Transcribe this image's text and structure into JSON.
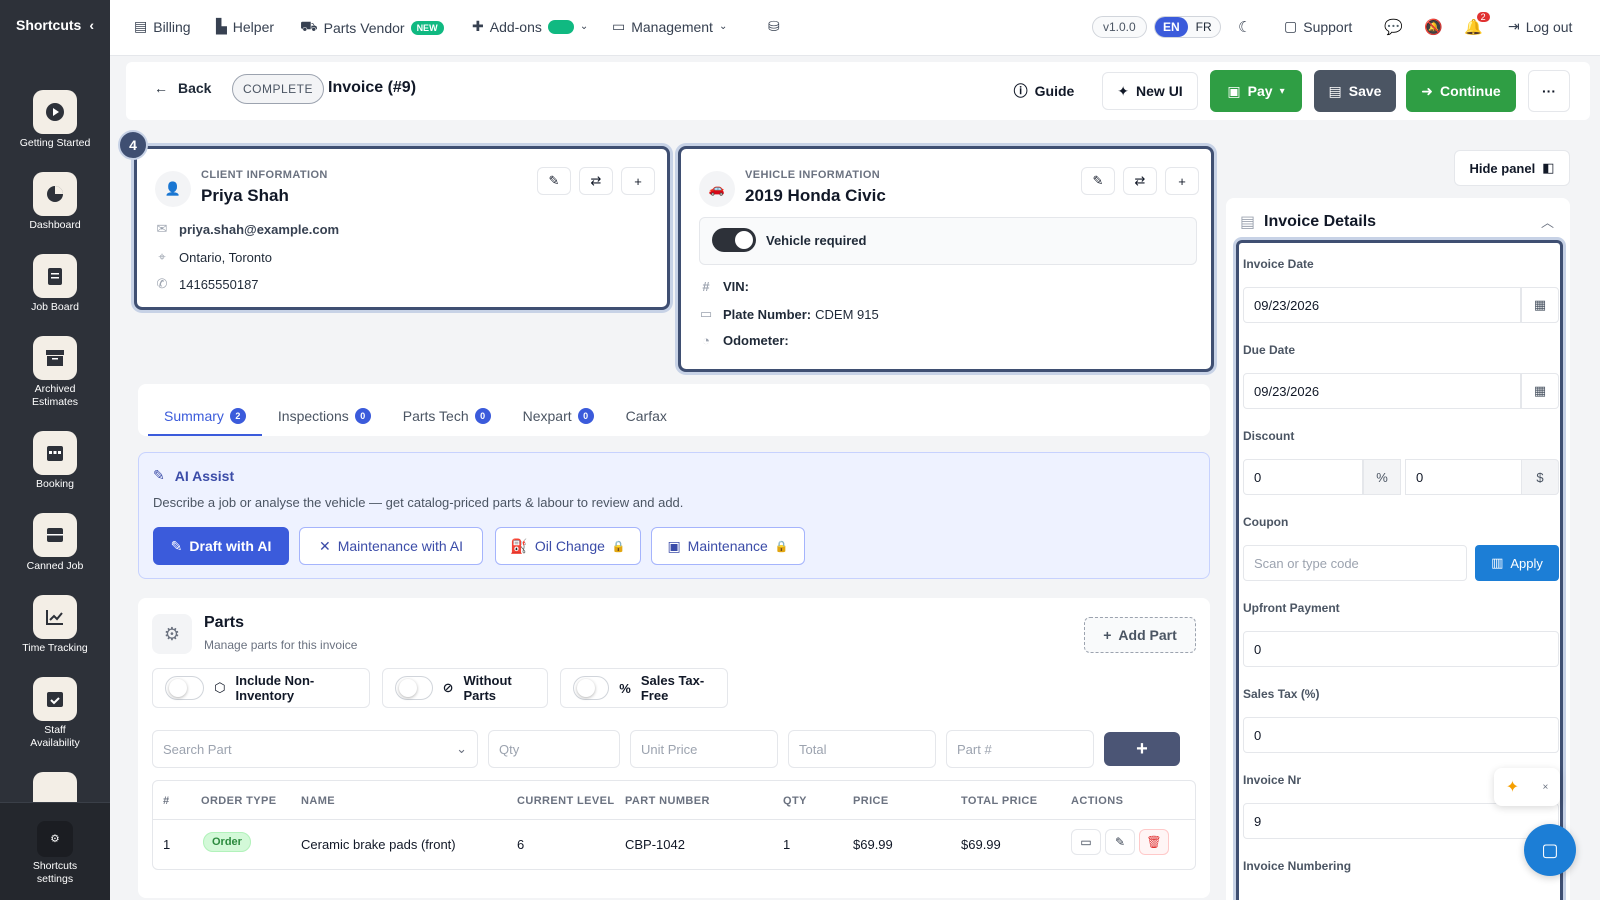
{
  "sidebar": {
    "title": "Shortcuts",
    "items": [
      {
        "label": "Getting Started",
        "icon": "play-icon"
      },
      {
        "label": "Dashboard",
        "icon": "pie-chart-icon"
      },
      {
        "label": "Job Board",
        "icon": "clipboard-icon"
      },
      {
        "label": "Archived Estimates",
        "icon": "archive-icon"
      },
      {
        "label": "Booking",
        "icon": "calendar-icon"
      },
      {
        "label": "Canned Job",
        "icon": "box-icon"
      },
      {
        "label": "Time Tracking",
        "icon": "chart-icon"
      },
      {
        "label": "Staff Availability",
        "icon": "calendar-check-icon"
      }
    ],
    "settings_label": "Shortcuts settings"
  },
  "topbar": {
    "billing": "Billing",
    "helper": "Helper",
    "parts_vendor": "Parts Vendor",
    "new_badge": "NEW",
    "addons": "Add-ons",
    "management": "Management",
    "version": "v1.0.0",
    "lang_en": "EN",
    "lang_fr": "FR",
    "support": "Support",
    "notif_count": "2",
    "logout": "Log out"
  },
  "subbar": {
    "back": "Back",
    "status": "COMPLETE",
    "title": "Invoice (#9)",
    "guide": "Guide",
    "new_ui": "New UI",
    "pay": "Pay",
    "save": "Save",
    "continue": "Continue",
    "more": "···"
  },
  "step_badge": "4",
  "client": {
    "section_label": "CLIENT INFORMATION",
    "name": "Priya Shah",
    "email": "priya.shah@example.com",
    "location": "Ontario, Toronto",
    "phone": "14165550187"
  },
  "vehicle": {
    "section_label": "VEHICLE INFORMATION",
    "name": "2019 Honda Civic",
    "required_label": "Vehicle required",
    "vin_label": "VIN:",
    "vin_value": "",
    "plate_label": "Plate Number:",
    "plate_value": "CDEM 915",
    "odometer_label": "Odometer:",
    "odometer_value": ""
  },
  "tabs": [
    {
      "label": "Summary",
      "count": "2"
    },
    {
      "label": "Inspections",
      "count": "0"
    },
    {
      "label": "Parts Tech",
      "count": "0"
    },
    {
      "label": "Nexpart",
      "count": "0"
    },
    {
      "label": "Carfax",
      "count": ""
    }
  ],
  "ai_assist": {
    "title": "AI Assist",
    "description": "Describe a job or analyse the vehicle — get catalog-priced parts & labour to review and add.",
    "draft": "Draft with AI",
    "maintenance_ai": "Maintenance with AI",
    "oil_change": "Oil Change",
    "maintenance": "Maintenance"
  },
  "parts": {
    "title": "Parts",
    "subtitle": "Manage parts for this invoice",
    "add_part": "Add Part",
    "include_non_inventory": "Include Non-Inventory",
    "without_parts": "Without Parts",
    "sales_tax_free": "Sales Tax-Free",
    "search_placeholder": "Search Part",
    "qty_placeholder": "Qty",
    "unit_price_placeholder": "Unit Price",
    "total_placeholder": "Total",
    "part_num_placeholder": "Part #",
    "columns": [
      "#",
      "ORDER TYPE",
      "NAME",
      "CURRENT LEVEL",
      "PART NUMBER",
      "QTY",
      "PRICE",
      "TOTAL PRICE",
      "ACTIONS"
    ],
    "rows": [
      {
        "num": "1",
        "order_type": "Order",
        "name": "Ceramic brake pads (front)",
        "level": "6",
        "part_number": "CBP-1042",
        "qty": "1",
        "price": "$69.99",
        "total": "$69.99"
      }
    ]
  },
  "right_panel": {
    "hide_panel": "Hide panel",
    "title": "Invoice Details",
    "invoice_date_label": "Invoice Date",
    "invoice_date": "09/23/2026",
    "due_date_label": "Due Date",
    "due_date": "09/23/2026",
    "discount_label": "Discount",
    "discount_pct": "0",
    "pct_symbol": "%",
    "discount_amt": "0",
    "dollar_symbol": "$",
    "coupon_label": "Coupon",
    "coupon_placeholder": "Scan or type code",
    "apply": "Apply",
    "upfront_label": "Upfront Payment",
    "upfront": "0",
    "sales_tax_label": "Sales Tax (%)",
    "sales_tax": "0",
    "invoice_nr_label": "Invoice Nr",
    "invoice_nr": "9",
    "invoice_numbering_label": "Invoice Numbering"
  },
  "colors": {
    "primary": "#3b5bdb",
    "green": "#2f9e44",
    "dark": "#2d3139",
    "outline": "#3f4f72"
  }
}
